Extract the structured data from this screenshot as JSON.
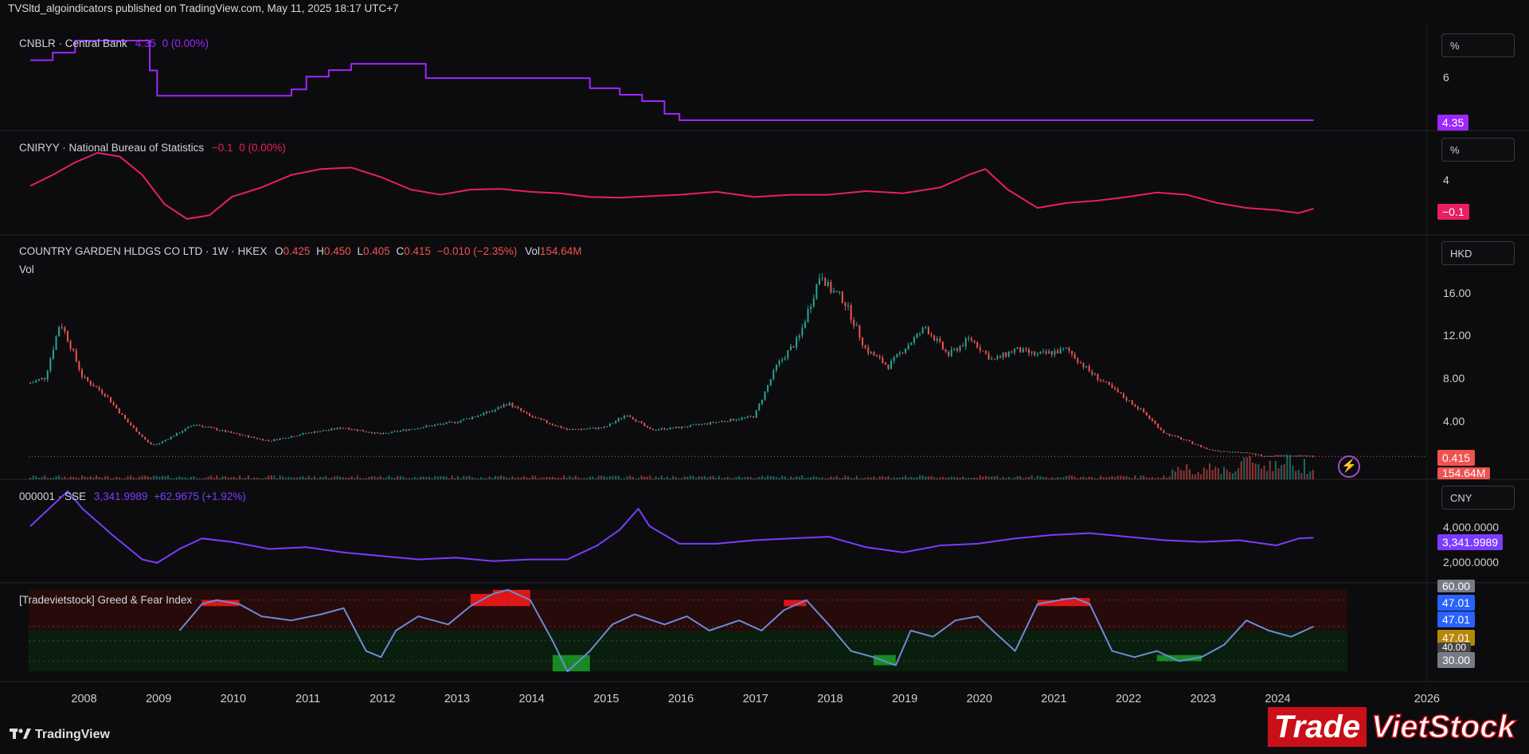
{
  "header": {
    "text": "TVSltd_algoindicators published on TradingView.com, May 11, 2025 18:17 UTC+7"
  },
  "footer": {
    "tv_label": "TradingView",
    "brand_a": "Trade",
    "brand_b": "VietStock"
  },
  "colors": {
    "cnblr": "#9c27ff",
    "cniryy": "#e91e63",
    "sse": "#7b3cff",
    "up": "#26a69a",
    "down": "#ef5350",
    "gf": "#6c8bd8"
  },
  "panes": {
    "cnblr": {
      "name": "CNBLR · Central Bank",
      "value": "4.35",
      "chg": "0 (0.00%)",
      "unit": "%",
      "tick": "6",
      "badge": "4.35"
    },
    "cniryy": {
      "name": "CNIRYY · National Bureau of Statistics",
      "value": "−0.1",
      "chg": "0 (0.00%)",
      "unit": "%",
      "tick": "4",
      "badge": "−0.1"
    },
    "price": {
      "name": "COUNTRY GARDEN HLDGS CO LTD · 1W · HKEX",
      "o_l": "O",
      "o": "0.425",
      "h_l": "H",
      "h": "0.450",
      "l_l": "L",
      "l": "0.405",
      "c_l": "C",
      "c": "0.415",
      "chg": "−0.010 (−2.35%)",
      "vol_l": "Vol",
      "vol": "154.64M",
      "vol_name": "Vol",
      "unit": "HKD",
      "ticks": [
        "16.00",
        "12.00",
        "8.00",
        "4.00"
      ],
      "badge": "0.415",
      "badge2": "154.64M"
    },
    "sse": {
      "name": "000001 · SSE",
      "value": "3,341.9989",
      "chg": "+62.9675 (+1.92%)",
      "unit": "CNY",
      "ticks": [
        "4,000.0000",
        "2,000.0000"
      ],
      "badge": "3,341.9989"
    },
    "gf": {
      "name": "[Tradevietstock] Greed & Fear Index",
      "badges": [
        "60.00",
        "47.01",
        "47.01",
        "47.01",
        "40.00",
        "30.00"
      ]
    }
  },
  "x_labels": [
    "2008",
    "2009",
    "2010",
    "2011",
    "2012",
    "2013",
    "2014",
    "2015",
    "2016",
    "2017",
    "2018",
    "2019",
    "2020",
    "2021",
    "2022",
    "2023",
    "2024",
    "2026"
  ],
  "chart_data": [
    {
      "type": "line",
      "title": "CNBLR · Central Bank",
      "x": [
        2007.3,
        2007.6,
        2007.9,
        2008.7,
        2008.9,
        2009.0,
        2010.0,
        2010.8,
        2011.0,
        2011.3,
        2011.6,
        2012.4,
        2012.6,
        2013.5,
        2014.5,
        2014.8,
        2015.2,
        2015.5,
        2015.8,
        2016.0,
        2020.0,
        2024.5
      ],
      "values": [
        6.7,
        7.0,
        7.47,
        7.47,
        6.3,
        5.31,
        5.31,
        5.56,
        6.06,
        6.31,
        6.56,
        6.56,
        6.0,
        6.0,
        6.0,
        5.6,
        5.35,
        5.1,
        4.6,
        4.35,
        4.35,
        4.35
      ]
    },
    {
      "type": "line",
      "title": "CNIRYY · National Bureau of Statistics",
      "x": [
        2007.3,
        2007.6,
        2007.9,
        2008.2,
        2008.5,
        2008.8,
        2009.1,
        2009.4,
        2009.7,
        2010.0,
        2010.4,
        2010.8,
        2011.2,
        2011.6,
        2012.0,
        2012.4,
        2012.8,
        2013.2,
        2013.6,
        2014.0,
        2014.4,
        2014.8,
        2015.2,
        2015.6,
        2016.0,
        2016.5,
        2017.0,
        2017.5,
        2018.0,
        2018.5,
        2019.0,
        2019.5,
        2019.9,
        2020.1,
        2020.4,
        2020.8,
        2021.2,
        2021.6,
        2022.0,
        2022.4,
        2022.8,
        2023.2,
        2023.6,
        2024.0,
        2024.3,
        2024.5
      ],
      "values": [
        3.0,
        4.5,
        6.2,
        7.5,
        7.0,
        4.5,
        0.5,
        -1.5,
        -1.0,
        1.5,
        2.8,
        4.5,
        5.3,
        5.5,
        4.2,
        2.5,
        1.8,
        2.5,
        2.6,
        2.2,
        2.0,
        1.5,
        1.4,
        1.6,
        1.8,
        2.2,
        1.5,
        1.8,
        1.8,
        2.3,
        2.0,
        2.8,
        4.6,
        5.3,
        2.5,
        0.0,
        0.7,
        1.0,
        1.5,
        2.1,
        1.8,
        0.7,
        0.0,
        -0.3,
        -0.7,
        -0.1
      ]
    },
    {
      "type": "candlestick",
      "title": "COUNTRY GARDEN HLDGS CO LTD · 1W · HKEX",
      "ylabel": "HKD",
      "x": [
        2007.3,
        2007.5,
        2007.7,
        2007.8,
        2008.0,
        2008.3,
        2008.6,
        2008.9,
        2009.0,
        2009.5,
        2010.0,
        2010.5,
        2011.0,
        2011.5,
        2012.0,
        2012.5,
        2013.0,
        2013.5,
        2013.7,
        2014.0,
        2014.5,
        2015.0,
        2015.3,
        2015.6,
        2016.0,
        2016.5,
        2017.0,
        2017.3,
        2017.6,
        2017.9,
        2018.0,
        2018.2,
        2018.5,
        2018.8,
        2019.0,
        2019.3,
        2019.6,
        2019.9,
        2020.2,
        2020.5,
        2020.8,
        2021.2,
        2021.5,
        2021.8,
        2022.2,
        2022.5,
        2022.8,
        2023.1,
        2023.5,
        2023.8,
        2024.2,
        2024.5
      ],
      "values": [
        7.0,
        7.5,
        12.5,
        11.0,
        7.5,
        6.0,
        3.5,
        1.5,
        1.5,
        3.3,
        2.5,
        1.8,
        2.5,
        3.0,
        2.4,
        3.0,
        3.5,
        4.5,
        5.2,
        4.0,
        2.8,
        3.0,
        4.2,
        2.8,
        3.0,
        3.5,
        4.0,
        8.5,
        11.0,
        17.0,
        15.5,
        14.5,
        10.0,
        8.5,
        10.0,
        12.0,
        9.5,
        11.0,
        9.0,
        10.0,
        9.5,
        10.0,
        8.0,
        6.5,
        4.5,
        2.5,
        1.8,
        1.0,
        0.8,
        0.5,
        0.45,
        0.415
      ]
    },
    {
      "type": "line",
      "title": "000001 · SSE",
      "ylabel": "CNY",
      "x": [
        2007.3,
        2007.6,
        2007.8,
        2008.0,
        2008.4,
        2008.8,
        2009.0,
        2009.3,
        2009.6,
        2010.0,
        2010.5,
        2011.0,
        2011.5,
        2012.0,
        2012.5,
        2013.0,
        2013.5,
        2014.0,
        2014.5,
        2014.9,
        2015.2,
        2015.45,
        2015.6,
        2015.8,
        2016.0,
        2016.5,
        2017.0,
        2017.5,
        2018.0,
        2018.5,
        2019.0,
        2019.5,
        2020.0,
        2020.5,
        2021.0,
        2021.5,
        2022.0,
        2022.5,
        2023.0,
        2023.5,
        2024.0,
        2024.3,
        2024.5
      ],
      "values": [
        4000,
        5200,
        6000,
        5000,
        3500,
        2100,
        1900,
        2700,
        3300,
        3100,
        2700,
        2800,
        2500,
        2300,
        2100,
        2200,
        2000,
        2100,
        2100,
        2900,
        3800,
        5000,
        4000,
        3500,
        3000,
        3000,
        3200,
        3300,
        3400,
        2800,
        2500,
        2900,
        3000,
        3300,
        3500,
        3600,
        3400,
        3200,
        3100,
        3200,
        2900,
        3300,
        3342
      ]
    },
    {
      "type": "line",
      "title": "[Tradevietstock] Greed & Fear Index",
      "x": [
        2009.3,
        2009.6,
        2009.8,
        2010.1,
        2010.4,
        2010.8,
        2011.2,
        2011.5,
        2011.8,
        2012.0,
        2012.2,
        2012.5,
        2012.9,
        2013.2,
        2013.5,
        2013.7,
        2014.0,
        2014.3,
        2014.5,
        2014.8,
        2015.1,
        2015.4,
        2015.8,
        2016.1,
        2016.4,
        2016.8,
        2017.1,
        2017.4,
        2017.7,
        2018.0,
        2018.3,
        2018.6,
        2018.9,
        2019.1,
        2019.4,
        2019.7,
        2020.0,
        2020.2,
        2020.5,
        2020.8,
        2021.1,
        2021.3,
        2021.5,
        2021.8,
        2022.1,
        2022.4,
        2022.7,
        2023.0,
        2023.3,
        2023.6,
        2023.9,
        2024.2,
        2024.5
      ],
      "values": [
        45,
        58,
        60,
        58,
        52,
        50,
        53,
        56,
        35,
        32,
        45,
        52,
        48,
        57,
        63,
        65,
        60,
        40,
        25,
        35,
        48,
        53,
        48,
        52,
        45,
        50,
        45,
        55,
        60,
        48,
        35,
        32,
        28,
        45,
        42,
        50,
        52,
        45,
        35,
        58,
        60,
        61,
        58,
        35,
        32,
        35,
        30,
        32,
        38,
        50,
        45,
        42,
        47
      ]
    }
  ]
}
